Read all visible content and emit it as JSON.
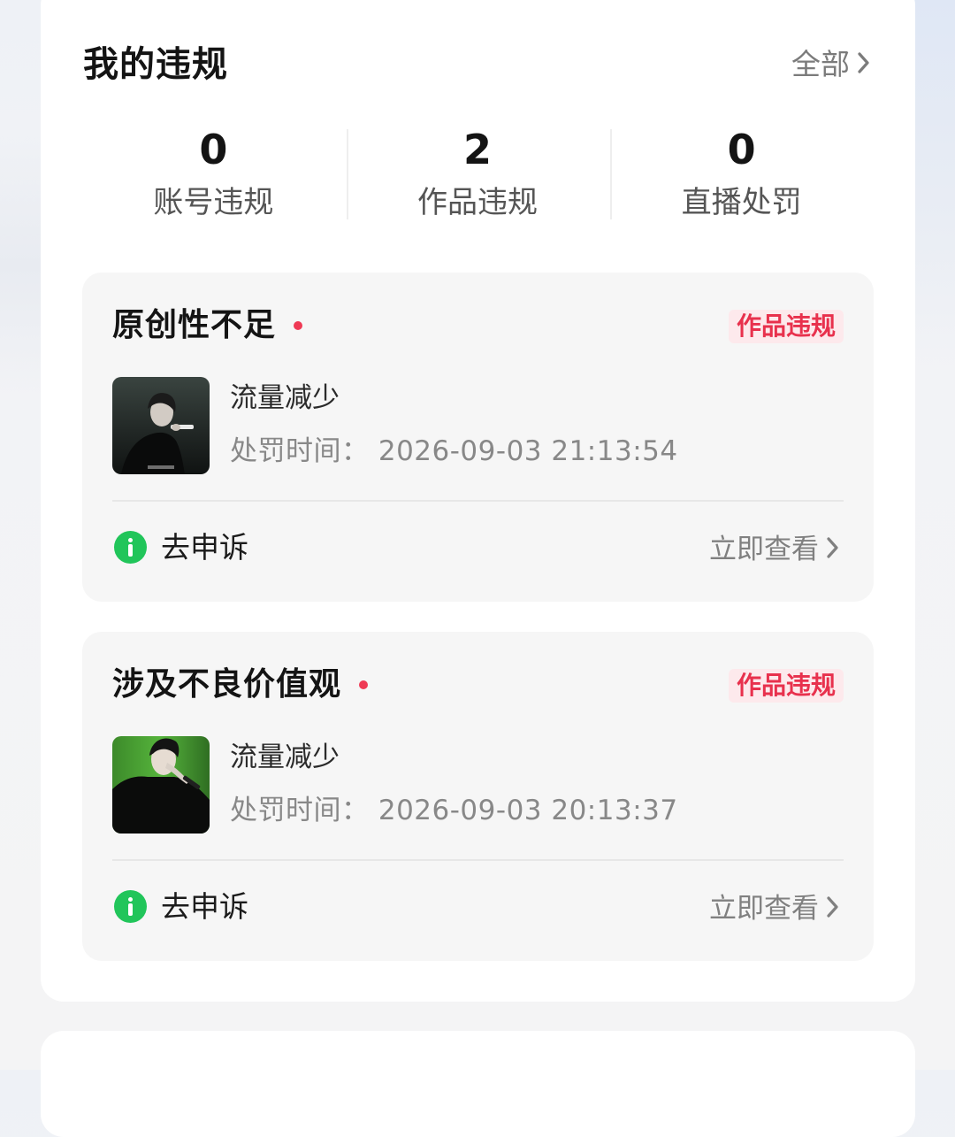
{
  "header": {
    "title": "我的违规",
    "all_label": "全部"
  },
  "stats": [
    {
      "value": "0",
      "label": "账号违规"
    },
    {
      "value": "2",
      "label": "作品违规"
    },
    {
      "value": "0",
      "label": "直播处罚"
    }
  ],
  "violations": [
    {
      "title": "原创性不足",
      "badge": "作品违规",
      "result": "流量减少",
      "time": "处罚时间：  2026-09-03  21:13:54",
      "appeal_label": "去申诉",
      "view_label": "立即查看"
    },
    {
      "title": "涉及不良价值观",
      "badge": "作品违规",
      "result": "流量减少",
      "time": "处罚时间：  2026-09-03  20:13:37",
      "appeal_label": "去申诉",
      "view_label": "立即查看"
    }
  ],
  "colors": {
    "accent_red": "#e8314d",
    "badge_bg": "#fde9ec",
    "info_green": "#21c55a",
    "card_bg": "#f6f6f6"
  },
  "icons": {
    "header_chevron": "chevron-right-icon",
    "appeal_icon": "info-icon",
    "view_chevron": "chevron-right-icon"
  }
}
